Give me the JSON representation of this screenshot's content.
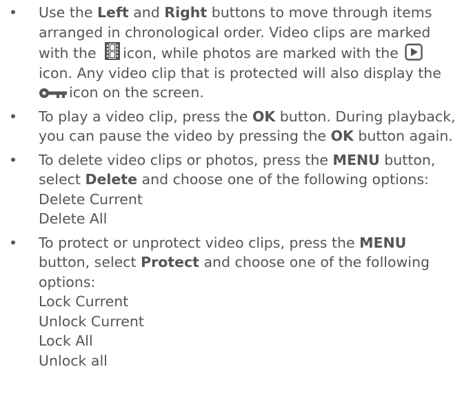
{
  "bullet_char": "•",
  "items": [
    {
      "p1": "Use the ",
      "b1": "Left",
      "p2": " and ",
      "b2": "Right",
      "p3": " buttons to move through items arranged in chronological order. Video clips are marked with the ",
      "icon1": "film-strip-icon",
      "p4": "icon, while photos are marked with the ",
      "icon2": "play-icon",
      "p5": " icon.  Any video clip that is protected will also display the ",
      "icon3": "key-icon",
      "p6": "icon on the screen."
    },
    {
      "p1": "To play a video clip, press the ",
      "b1": "OK",
      "p2": " button. During playback, you can pause the video by pressing the ",
      "b2": "OK",
      "p3": " button again."
    },
    {
      "p1": "To delete video clips or photos, press the ",
      "b1": "MENU",
      "p2": " button, select ",
      "b2": "Delete",
      "p3": " and choose one of the following options:",
      "options": [
        "Delete Current",
        "Delete All"
      ]
    },
    {
      "p1": "To protect or unprotect video clips, press the ",
      "b1": "MENU",
      "p2": " button, select ",
      "b2": "Protect",
      "p3": " and choose one of the following options:",
      "options": [
        "Lock Current",
        "Unlock Current",
        "Lock All",
        "Unlock all"
      ]
    }
  ]
}
